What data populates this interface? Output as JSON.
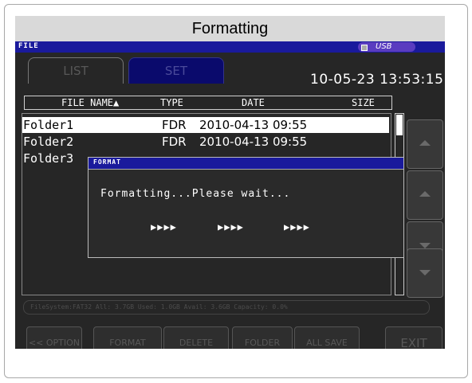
{
  "caption": "Formatting",
  "topbar": {
    "title": "FILE",
    "usb_label": "USB"
  },
  "tabs": [
    {
      "label": "LIST"
    },
    {
      "label": "SET"
    }
  ],
  "clock": "10-05-23  13:53:15",
  "table": {
    "headers": {
      "name": "FILE NAME▲",
      "type": "TYPE",
      "date": "DATE",
      "size": "SIZE"
    },
    "rows": [
      {
        "name": "Folder1",
        "type": "FDR",
        "date": "2010-04-13 09:55"
      },
      {
        "name": "Folder2",
        "type": "FDR",
        "date": "2010-04-13 09:55"
      },
      {
        "name": "Folder3",
        "type": "",
        "date": ""
      }
    ]
  },
  "status_line": "FileSystem:FAT32 All: 3.7GB Used: 1.0GB Avail: 3.6GB Capacity: 0.0%",
  "bottom_buttons": [
    {
      "label": "<< OPTION"
    },
    {
      "label": "FORMAT"
    },
    {
      "label": "DELETE"
    },
    {
      "label": "FOLDER"
    },
    {
      "label": "ALL SAVE"
    },
    {
      "label": "EXIT"
    }
  ],
  "dialog": {
    "title": "FORMAT",
    "message": "Formatting...Please wait...",
    "progress": [
      "▶▶▶▶",
      "▶▶▶▶",
      "▶▶▶▶"
    ]
  },
  "colors": {
    "title_bar": "#1a1a9c",
    "screen_bg": "#262626",
    "usb_badge": "#5a3cc0"
  },
  "icons": {
    "usb": "usb-icon",
    "scroll_up": "triangle-up-icon",
    "scroll_down": "triangle-down-icon"
  }
}
